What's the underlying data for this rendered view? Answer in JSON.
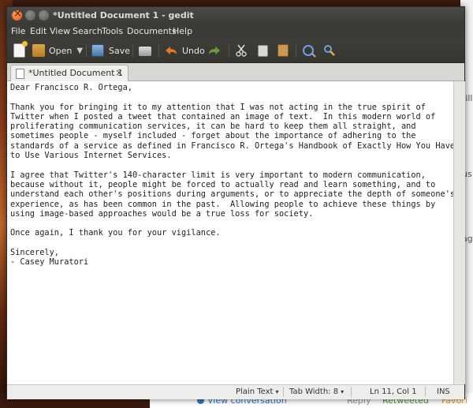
{
  "window": {
    "title": "*Untitled Document 1 - gedit"
  },
  "menu": [
    "File",
    "Edit",
    "View",
    "Search",
    "Tools",
    "Documents",
    "Help"
  ],
  "toolbar": {
    "open_label": "Open",
    "save_label": "Save",
    "undo_label": "Undo"
  },
  "tab": {
    "label": "*Untitled Document 1",
    "close": "×"
  },
  "document": {
    "text": "Dear Francisco R. Ortega,\n\nThank you for bringing it to my attention that I was not acting in the true spirit of\nTwitter when I posted a tweet that contained an image of text.  In this modern world of\nproliferating communication services, it can be hard to keep them all straight, and\nsometimes people - myself included - forget about the importance of adhering to the\nstandards of a service as defined in Francisco R. Ortega's Handbook of Exactly How You Have\nto Use Various Internet Services.\n\nI agree that Twitter's 140-character limit is very important to modern communication,\nbecause without it, people might be forced to actually read and learn something, and to\nunderstand each other's positions during arguments, or to appreciate the depth of someone's\nexperience, as has been common in the past.  Allowing people to achieve these things by\nusing image-based approaches would be a true loss for society.\n\nOnce again, I thank you for your vigilance.\n\nSincerely,\n- Casey Muratori"
  },
  "statusbar": {
    "language": "Plain Text",
    "tab_width": "Tab Width: 8",
    "position": "Ln 11, Col 1",
    "mode": "INS"
  },
  "background": {
    "right_fragments": [
      "till",
      "us",
      "ag"
    ],
    "view_conversation": "View conversation",
    "reply": "Reply",
    "retweeted": "Retweeted",
    "favorite": "Favori"
  }
}
